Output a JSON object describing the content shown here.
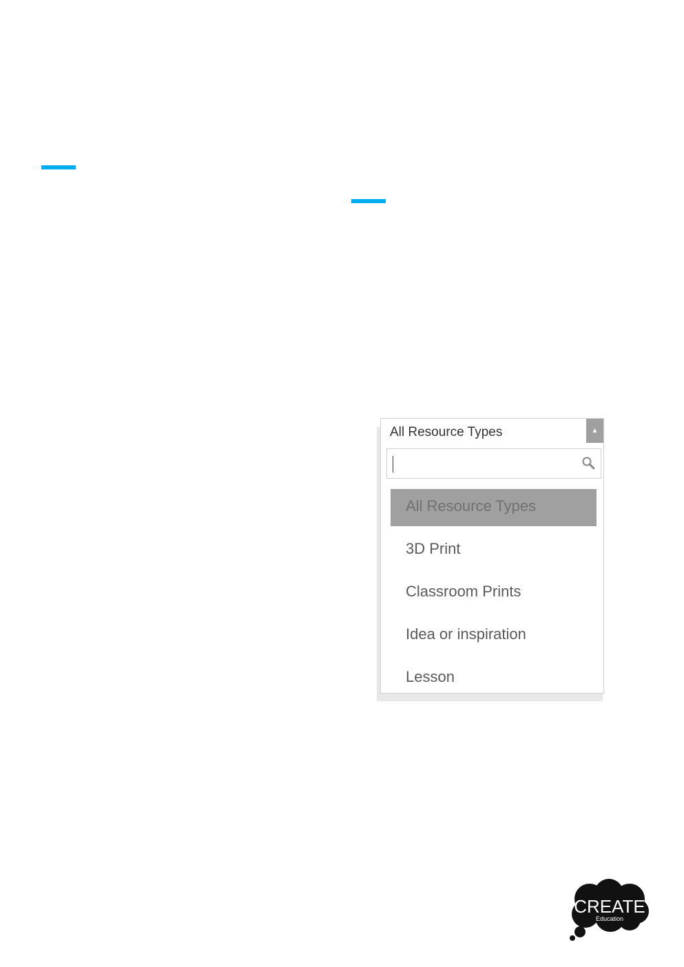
{
  "dropdown": {
    "selected_label": "All Resource Types",
    "search": {
      "value": "",
      "placeholder": ""
    },
    "options": [
      {
        "label": "All Resource Types",
        "highlighted": true
      },
      {
        "label": "3D Print"
      },
      {
        "label": "Classroom Prints"
      },
      {
        "label": "Idea or inspiration"
      },
      {
        "label": "Lesson"
      }
    ]
  },
  "logo": {
    "name": "CREATE",
    "sub": "Education"
  },
  "colors": {
    "accent": "#00aeef",
    "highlight": "#a0a0a0"
  },
  "icons": {
    "search": "search-icon",
    "arrow": "arrow-up-icon"
  }
}
